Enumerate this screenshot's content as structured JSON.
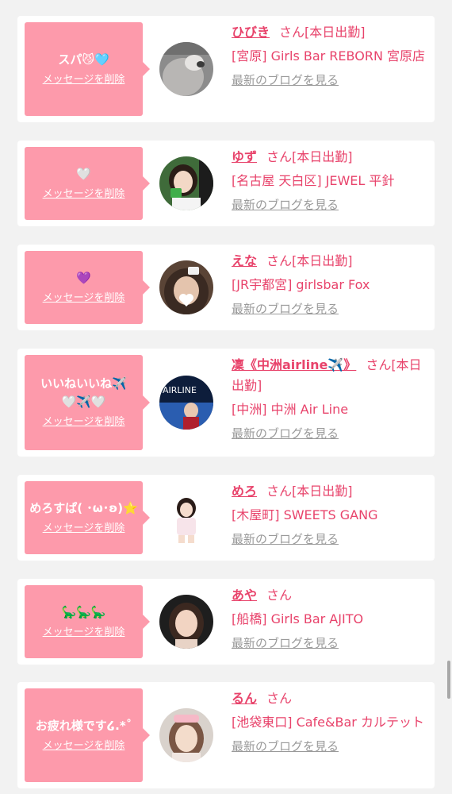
{
  "colors": {
    "bubble": "#fd9aab",
    "accent": "#e8436b",
    "link_gray": "#9a9a9a",
    "background": "#f2f2f2"
  },
  "common": {
    "delete_label": "メッセージを削除",
    "blog_label": "最新のブログを見る"
  },
  "items": [
    {
      "message": "スパ😼🩵",
      "name": "ひびき",
      "suffix": "さん[本日出勤]",
      "shop": "[宮原] Girls Bar REBORN 宮原店",
      "avatar_icon": "gray-portrait"
    },
    {
      "message": "🤍",
      "name": "ゆず",
      "suffix": "さん[本日出勤]",
      "shop": "[名古屋 天白区] JEWEL 平針",
      "avatar_icon": "portrait-green"
    },
    {
      "message": "💜",
      "name": "えな",
      "suffix": "さん[本日出勤]",
      "shop": "[JR宇都宮] girlsbar Fox",
      "avatar_icon": "portrait-heart"
    },
    {
      "message_lines": [
        "いいねいいね✈️",
        "🤍✈️🤍"
      ],
      "name": "凜《中洲airline✈️》",
      "suffix": "さん[本日出勤]",
      "shop": "[中洲] 中洲 Air Line",
      "avatar_icon": "airline-portrait"
    },
    {
      "message": "めろすぱ( ･ω･ʚ)⭐️",
      "name": "めろ",
      "suffix": "さん[本日出勤]",
      "shop": "[木屋町] SWEETS GANG",
      "avatar_icon": "portrait-white"
    },
    {
      "message": "🦕🦕🦕",
      "name": "あや",
      "suffix": "さん",
      "shop": "[船橋] Girls Bar AJITO",
      "avatar_icon": "portrait-dark"
    },
    {
      "message": "お疲れ様です໒.*˚",
      "name": "るん",
      "suffix": "さん",
      "shop": "[池袋東口] Cafe&Bar カルテット",
      "avatar_icon": "portrait-nurse"
    }
  ]
}
